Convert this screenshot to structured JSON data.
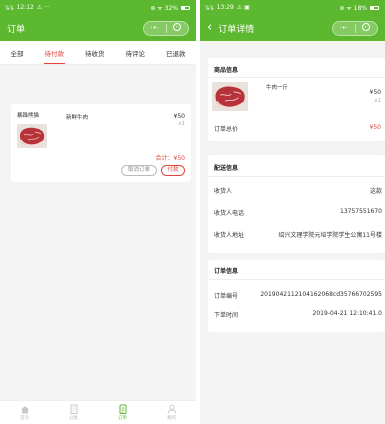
{
  "left": {
    "status": {
      "carrier": "᪻ᵴ ᪻ᵴ",
      "time": "12:12",
      "extra": "⚠ ···",
      "right": "⊛ ᯤ 32%"
    },
    "nav": {
      "title": "订单"
    },
    "capsule": {
      "menu": "·•·"
    },
    "tabs": [
      {
        "label": "全部"
      },
      {
        "label": "待付款"
      },
      {
        "label": "待收货"
      },
      {
        "label": "待评论"
      },
      {
        "label": "已退款"
      }
    ],
    "order": {
      "shop": "暴躁熊猫",
      "product": "新鲜牛肉",
      "price": "¥50",
      "qty": "x1",
      "total": "合计：¥50",
      "cancel_label": "取消订单",
      "pay_label": "付款"
    },
    "tabbar": [
      {
        "label": "首页",
        "icon": "home-icon"
      },
      {
        "label": "分类",
        "icon": "building-icon"
      },
      {
        "label": "订单",
        "icon": "order-icon"
      },
      {
        "label": "我的",
        "icon": "user-icon"
      }
    ],
    "colors": {
      "brand": "#5cb82e",
      "accent": "#e0443b"
    }
  },
  "right": {
    "status": {
      "carrier": "᪻ᵴ ᪻ᵴ",
      "time": "13:29",
      "extra": "⚠ ▣",
      "right": "⊛ ᯤ 18%"
    },
    "nav": {
      "back": "‹",
      "title": "订单详情"
    },
    "capsule": {
      "menu": "·•·"
    },
    "product_section": {
      "title": "商品信息",
      "product": "牛肉一斤",
      "price": "¥50",
      "qty": "x1",
      "total_label": "订单总价",
      "total_value": "¥50"
    },
    "delivery": {
      "title": "配送信息",
      "rows": [
        {
          "label": "收货人",
          "value": "这款"
        },
        {
          "label": "收货人电话",
          "value": "13757551670"
        },
        {
          "label": "收货人地址",
          "value": "绍兴文理学院元培学院学生公寓11号楼"
        }
      ]
    },
    "order_info": {
      "title": "订单信息",
      "rows": [
        {
          "label": "订单编号",
          "value": "2019042112104162068cd35766702595"
        },
        {
          "label": "下单时间",
          "value": "2019-04-21 12:10:41.0"
        }
      ]
    }
  }
}
